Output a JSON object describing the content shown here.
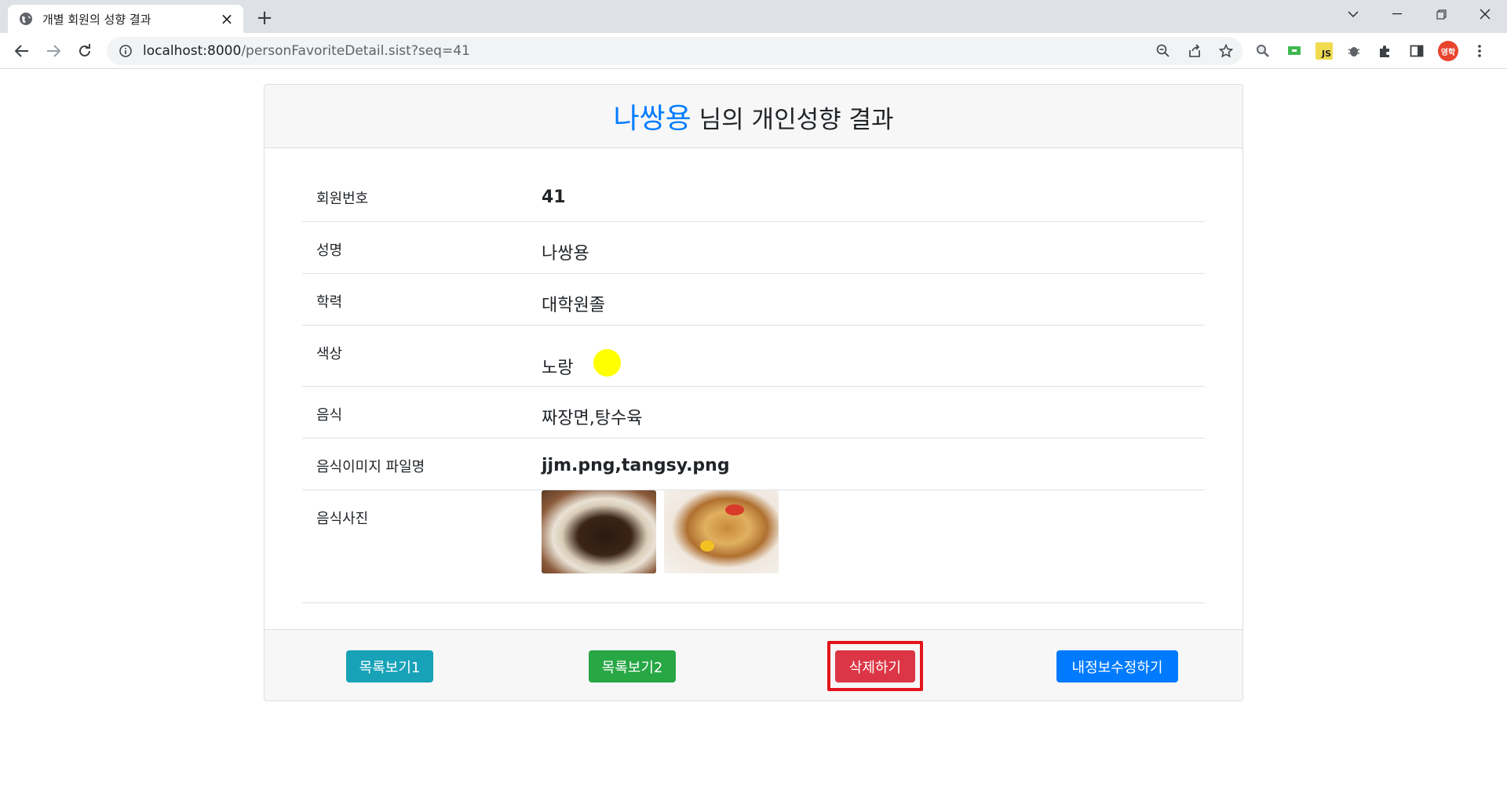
{
  "browser": {
    "tab_title": "개별 회원의 성향 결과",
    "url_host": "localhost:8000",
    "url_path": "/personFavoriteDetail.sist?seq=41",
    "profile_initials": "영학",
    "js_ext_label": "JS"
  },
  "page": {
    "header_name": "나쌍용",
    "header_suffix": " 님의 개인성향 결과",
    "rows": {
      "member_no": {
        "label": "회원번호",
        "value": "41"
      },
      "name": {
        "label": "성명",
        "value": "나쌍용"
      },
      "education": {
        "label": "학력",
        "value": "대학원졸"
      },
      "color": {
        "label": "색상",
        "value": "노랑",
        "swatch": "#ffff00"
      },
      "food": {
        "label": "음식",
        "value": "짜장면,탕수육"
      },
      "food_files": {
        "label": "음식이미지 파일명",
        "value": "jjm.png,tangsy.png"
      },
      "food_photos": {
        "label": "음식사진"
      }
    }
  },
  "buttons": {
    "list1": "목록보기1",
    "list2": "목록보기2",
    "delete": "삭제하기",
    "edit": "내정보수정하기"
  },
  "colors": {
    "accent": "#007bff",
    "info": "#17a2b8",
    "success": "#28a745",
    "danger": "#dc3545",
    "highlight": "#e4141c"
  }
}
